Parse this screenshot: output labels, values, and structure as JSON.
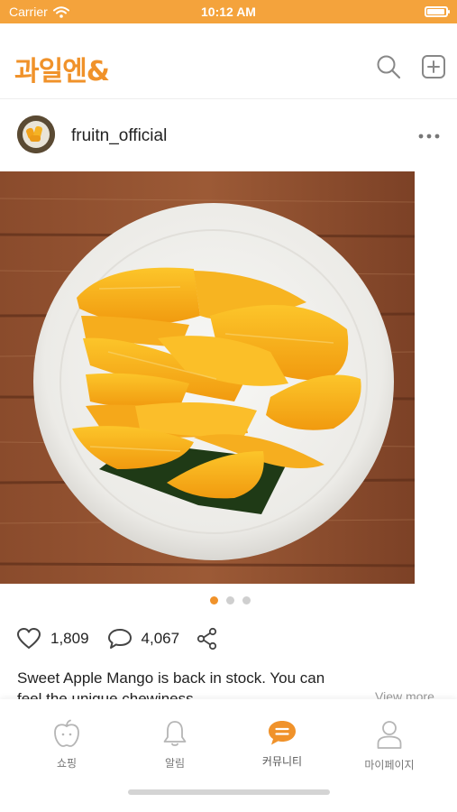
{
  "status_bar": {
    "carrier": "Carrier",
    "time": "10:12 AM",
    "battery_level": 0.95
  },
  "header": {
    "logo": "과일엔&",
    "icons": [
      "search-icon",
      "plus-square-icon"
    ]
  },
  "post": {
    "username": "fruitn_official",
    "image_description_icon": "mango-plate-photo",
    "carousel": {
      "count": 3,
      "active": 1
    },
    "likes": "1,809",
    "comments": "4,067",
    "caption_line1": "Sweet Apple Mango is back in stock. You can",
    "caption_line2": "feel the unique chewiness",
    "view_more": "View more"
  },
  "tabs": [
    {
      "label": "쇼핑",
      "icon": "apple-icon"
    },
    {
      "label": "알림",
      "icon": "bell-icon"
    },
    {
      "label": "커뮤니티",
      "icon": "chat-bubble-icon",
      "active": true
    },
    {
      "label": "마이페이지",
      "icon": "person-icon"
    }
  ],
  "colors": {
    "accent": "#f0922a",
    "status_bar": "#f4a33c"
  }
}
